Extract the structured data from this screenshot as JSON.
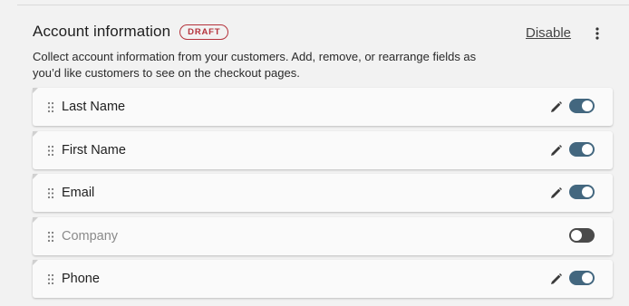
{
  "section": {
    "title": "Account information",
    "badge": "DRAFT",
    "disable_label": "Disable",
    "more_icon": "kebab-vertical-icon",
    "description": "Collect account information from your customers. Add, remove, or rearrange fields as you’d like customers to see on the checkout pages."
  },
  "fields": [
    {
      "label": "Last Name",
      "enabled": true,
      "editable": true
    },
    {
      "label": "First Name",
      "enabled": true,
      "editable": true
    },
    {
      "label": "Email",
      "enabled": true,
      "editable": true
    },
    {
      "label": "Company",
      "enabled": false,
      "editable": false
    },
    {
      "label": "Phone",
      "enabled": true,
      "editable": true
    }
  ],
  "colors": {
    "badge": "#b4323b",
    "toggle_on": "#43677f",
    "toggle_off": "#4a4a4a"
  },
  "icons": {
    "drag": "drag-handle-icon",
    "edit": "pencil-icon"
  }
}
